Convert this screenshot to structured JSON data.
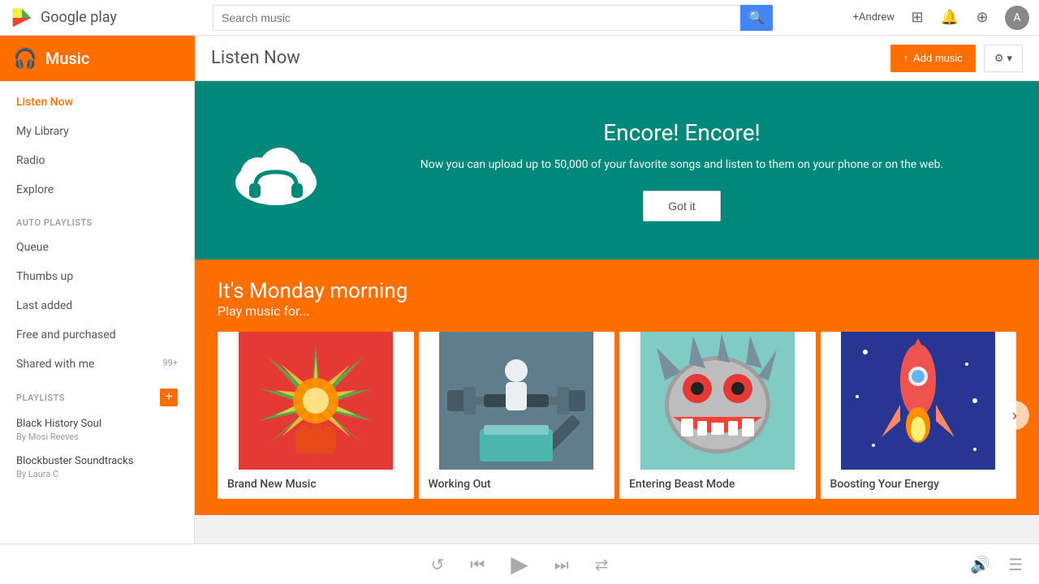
{
  "topbar": {
    "logo_text": "Google play",
    "search_placeholder": "Search music",
    "search_btn_icon": "🔍",
    "user_name": "+Andrew",
    "icons": [
      "⊞",
      "🔔",
      "⊕"
    ]
  },
  "subheader": {
    "music_label": "Music",
    "page_title": "Listen Now",
    "add_music_label": "Add music",
    "settings_label": "⚙"
  },
  "sidebar": {
    "nav": [
      {
        "label": "Listen Now",
        "active": true
      },
      {
        "label": "My Library",
        "active": false
      },
      {
        "label": "Radio",
        "active": false
      },
      {
        "label": "Explore",
        "active": false
      }
    ],
    "auto_playlists_section": "AUTO PLAYLISTS",
    "auto_playlists": [
      {
        "label": "Queue"
      },
      {
        "label": "Thumbs up"
      },
      {
        "label": "Last added"
      },
      {
        "label": "Free and purchased"
      },
      {
        "label": "Shared with me",
        "badge": "99+"
      }
    ],
    "playlists_section": "PLAYLISTS",
    "playlists": [
      {
        "title": "Black History Soul",
        "by": "By Mosi Reeves"
      },
      {
        "title": "Blockbuster Soundtracks",
        "by": "By Laura C"
      }
    ]
  },
  "encore": {
    "title": "Encore! Encore!",
    "subtitle": "Now you can upload up to 50,000 of your favorite songs and\nlisten to them on your phone or on the web.",
    "button": "Got it"
  },
  "monday": {
    "title": "It's Monday morning",
    "subtitle": "Play music for...",
    "next_icon": "›",
    "cards": [
      {
        "label": "Brand New Music",
        "bg": "#e53935"
      },
      {
        "label": "Working Out",
        "bg": "#546e7a"
      },
      {
        "label": "Entering Beast Mode",
        "bg": "#80cbc4"
      },
      {
        "label": "Boosting Your Energy",
        "bg": "#283593"
      }
    ]
  },
  "player": {
    "shuffle": "⇄",
    "prev": "⏮",
    "play": "▶",
    "next": "⏭",
    "repeat": "↺",
    "volume": "🔊",
    "queue": "☰"
  }
}
